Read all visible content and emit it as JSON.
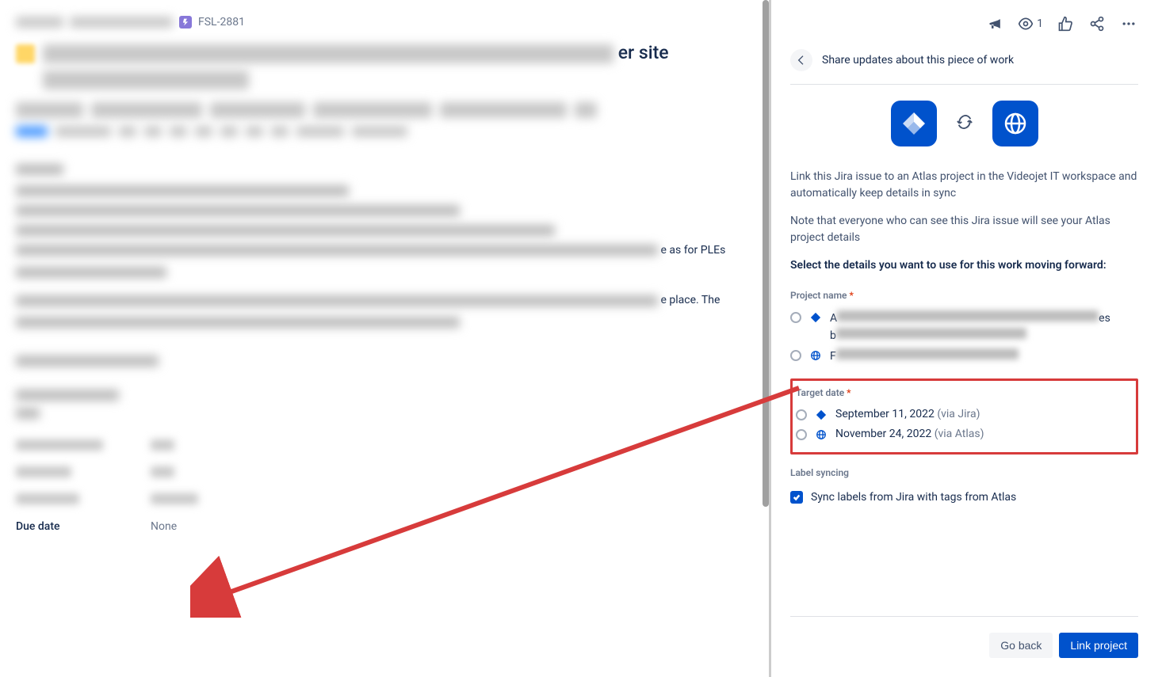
{
  "breadcrumb": {
    "issue_key": "FSL-2881"
  },
  "title": {
    "visible_fragment": "er site"
  },
  "description": {
    "visible_fragment_1": "e as for PLEs",
    "visible_fragment_2": "e place. The"
  },
  "due_date": {
    "label": "Due date",
    "value": "None"
  },
  "header": {
    "watchers": "1"
  },
  "panel": {
    "share_title": "Share updates about this piece of work",
    "info_1": "Link this Jira issue to an Atlas project in the Videojet IT workspace and automatically keep details in sync",
    "info_2": "Note that everyone who can see this Jira issue will see your Atlas project details",
    "select_title": "Select the details you want to use for this work moving forward:",
    "project_name_label": "Project name",
    "project_options": [
      {
        "first_letter": "A",
        "second_line_letter": "b"
      },
      {
        "first_letter": "F"
      }
    ],
    "target_date_label": "Target date",
    "dates": [
      {
        "date": "September 11, 2022",
        "via": "(via Jira)",
        "source": "jira"
      },
      {
        "date": "November 24, 2022",
        "via": "(via Atlas)",
        "source": "atlas"
      }
    ],
    "label_syncing_label": "Label syncing",
    "label_syncing_text": "Sync labels from Jira with tags from Atlas",
    "go_back": "Go back",
    "link_project": "Link project"
  }
}
